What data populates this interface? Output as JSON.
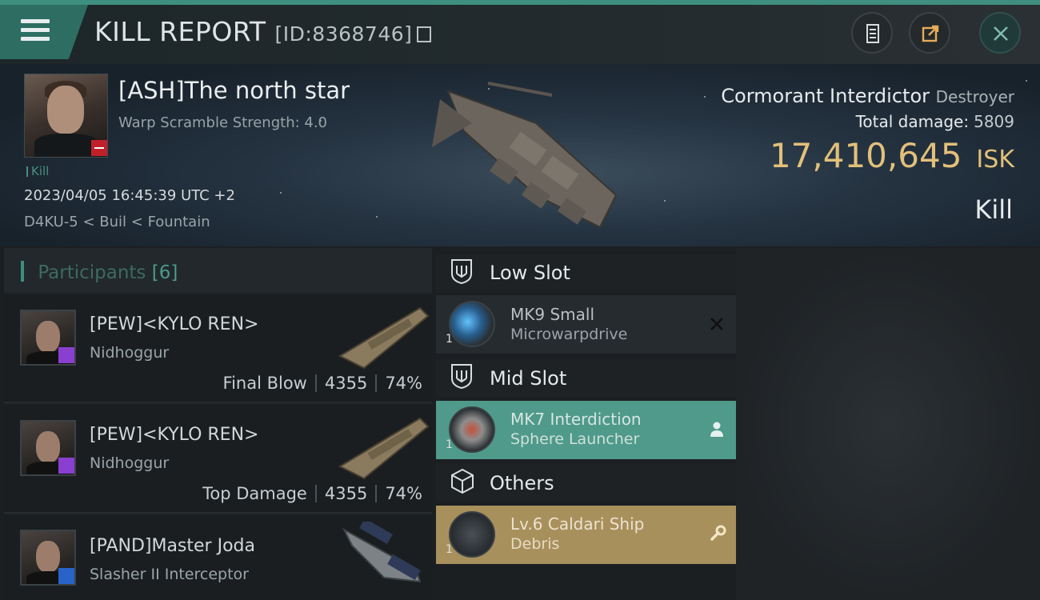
{
  "header": {
    "title": "KILL REPORT",
    "id_label": "[ID:8368746]"
  },
  "banner": {
    "pilot_name": "[ASH]The north star",
    "warp_scramble": "Warp Scramble Strength: 4.0",
    "tag": "Kill",
    "datetime": "2023/04/05 16:45:39 UTC +2",
    "location": "D4KU-5 < Buil < Fountain",
    "ship_name": "Cormorant Interdictor",
    "ship_class": "Destroyer",
    "total_damage_label": "Total damage:",
    "total_damage_value": "5809",
    "isk_value": "17,410,645",
    "isk_unit": "ISK",
    "result": "Kill"
  },
  "participants": {
    "title": "Participants",
    "count": "[6]",
    "rows": [
      {
        "name": "[PEW]<KYLO REN>",
        "ship": "Nidhoggur",
        "role": "Final Blow",
        "damage": "4355",
        "percent": "74%",
        "badge_color": "#8a3fd1"
      },
      {
        "name": "[PEW]<KYLO REN>",
        "ship": "Nidhoggur",
        "role": "Top Damage",
        "damage": "4355",
        "percent": "74%",
        "badge_color": "#8a3fd1"
      },
      {
        "name": "[PAND]Master Joda",
        "ship": "Slasher II Interceptor",
        "badge_color": "#2763c8"
      }
    ]
  },
  "slots": [
    {
      "title": "Low Slot",
      "items": [
        {
          "qty": "1",
          "line1": "MK9 Small",
          "line2": "Microwarpdrive",
          "status": "destroyed"
        }
      ]
    },
    {
      "title": "Mid Slot",
      "items": [
        {
          "qty": "1",
          "line1": "MK7 Interdiction",
          "line2": "Sphere Launcher",
          "status": "dropped"
        }
      ]
    },
    {
      "title": "Others",
      "items": [
        {
          "qty": "1",
          "line1": "Lv.6 Caldari Ship",
          "line2": "Debris",
          "status": "salvage"
        }
      ]
    }
  ],
  "colors": {
    "accent": "#3f8f80",
    "isk": "#e2c07a",
    "dropped_item": "#4f9a8a",
    "salvage_item": "#a8905d"
  },
  "icons": [
    "menu-icon",
    "copy-icon",
    "document-icon",
    "share-icon",
    "close-icon",
    "shield-slot-icon",
    "cube-icon",
    "person-icon",
    "wrench-icon",
    "x-mark-icon"
  ]
}
